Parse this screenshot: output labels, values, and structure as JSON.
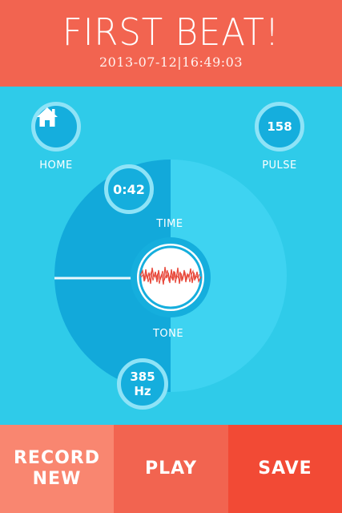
{
  "header": {
    "title": "FIRST BEAT!",
    "timestamp": "2013-07-12|16:49:03"
  },
  "nav": {
    "home_label": "HOME",
    "pulse_label": "PULSE",
    "pulse_value": "158"
  },
  "dial": {
    "time_value": "0:42",
    "time_label": "TIME",
    "tone_value": "385",
    "tone_unit": "Hz",
    "tone_label": "TONE"
  },
  "footer": {
    "record_line1": "RECORD",
    "record_line2": "NEW",
    "play_label": "PLAY",
    "save_label": "SAVE"
  },
  "colors": {
    "header_bg": "#f26450",
    "stage_bg": "#2fcbe9",
    "dial_fill": "#12a9da",
    "accent_blue": "#15aedd",
    "record_bg": "#f98670",
    "play_bg": "#f26450",
    "save_bg": "#f24a35",
    "waveform": "#e8493b"
  },
  "icons": {
    "home": "home-icon",
    "waveform": "waveform-icon"
  }
}
